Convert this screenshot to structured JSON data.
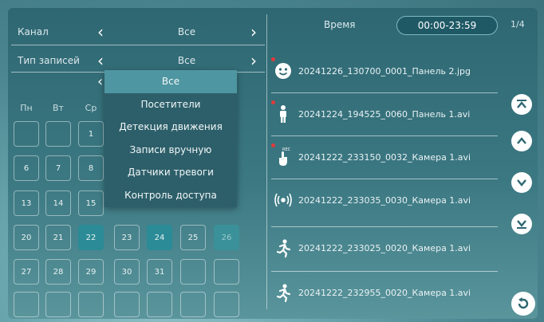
{
  "filters": {
    "channel_label": "Канал",
    "channel_value": "Все",
    "type_label": "Тип записей",
    "type_value": "Все"
  },
  "arrows": {
    "left": "‹",
    "right": "›"
  },
  "calendar": {
    "weekdays": [
      "Пн",
      "Вт",
      "Ср"
    ],
    "days": {
      "d1": "1",
      "d6": "6",
      "d7": "7",
      "d8": "8",
      "d13": "13",
      "d14": "14",
      "d15": "15",
      "d20": "20",
      "d21": "21",
      "d22": "22",
      "d23": "23",
      "d24": "24",
      "d25": "25",
      "d26": "26",
      "d27": "27",
      "d28": "28",
      "d29": "29",
      "d30": "30",
      "d31": "31"
    }
  },
  "dropdown": {
    "items": [
      "Все",
      "Посетители",
      "Детекция движения",
      "Записи вручную",
      "Датчики тревоги",
      "Контроль доступа"
    ]
  },
  "time": {
    "label": "Время",
    "range": "00:00-23:59"
  },
  "page_indicator": "1/4",
  "records": [
    {
      "name": "20241226_130700_0001_Панель 2.jpg",
      "icon": "visitor-face-icon",
      "new": true
    },
    {
      "name": "20241224_194525_0060_Панель 1.avi",
      "icon": "person-icon",
      "new": true
    },
    {
      "name": "20241222_233150_0032_Камера 1.avi",
      "icon": "manual-record-hand-icon",
      "new": true
    },
    {
      "name": "20241222_233035_0030_Камера 1.avi",
      "icon": "alarm-sensor-icon",
      "new": false
    },
    {
      "name": "20241222_233025_0020_Камера 1.avi",
      "icon": "motion-runner-icon",
      "new": false
    },
    {
      "name": "20241222_232955_0020_Камера 1.avi",
      "icon": "motion-runner-icon",
      "new": false
    }
  ],
  "colors": {
    "accent": "#2b8b96",
    "selected": "#4e96a1",
    "dropdown_bg": "#2d5f6a",
    "new_dot": "#e23a3a"
  }
}
